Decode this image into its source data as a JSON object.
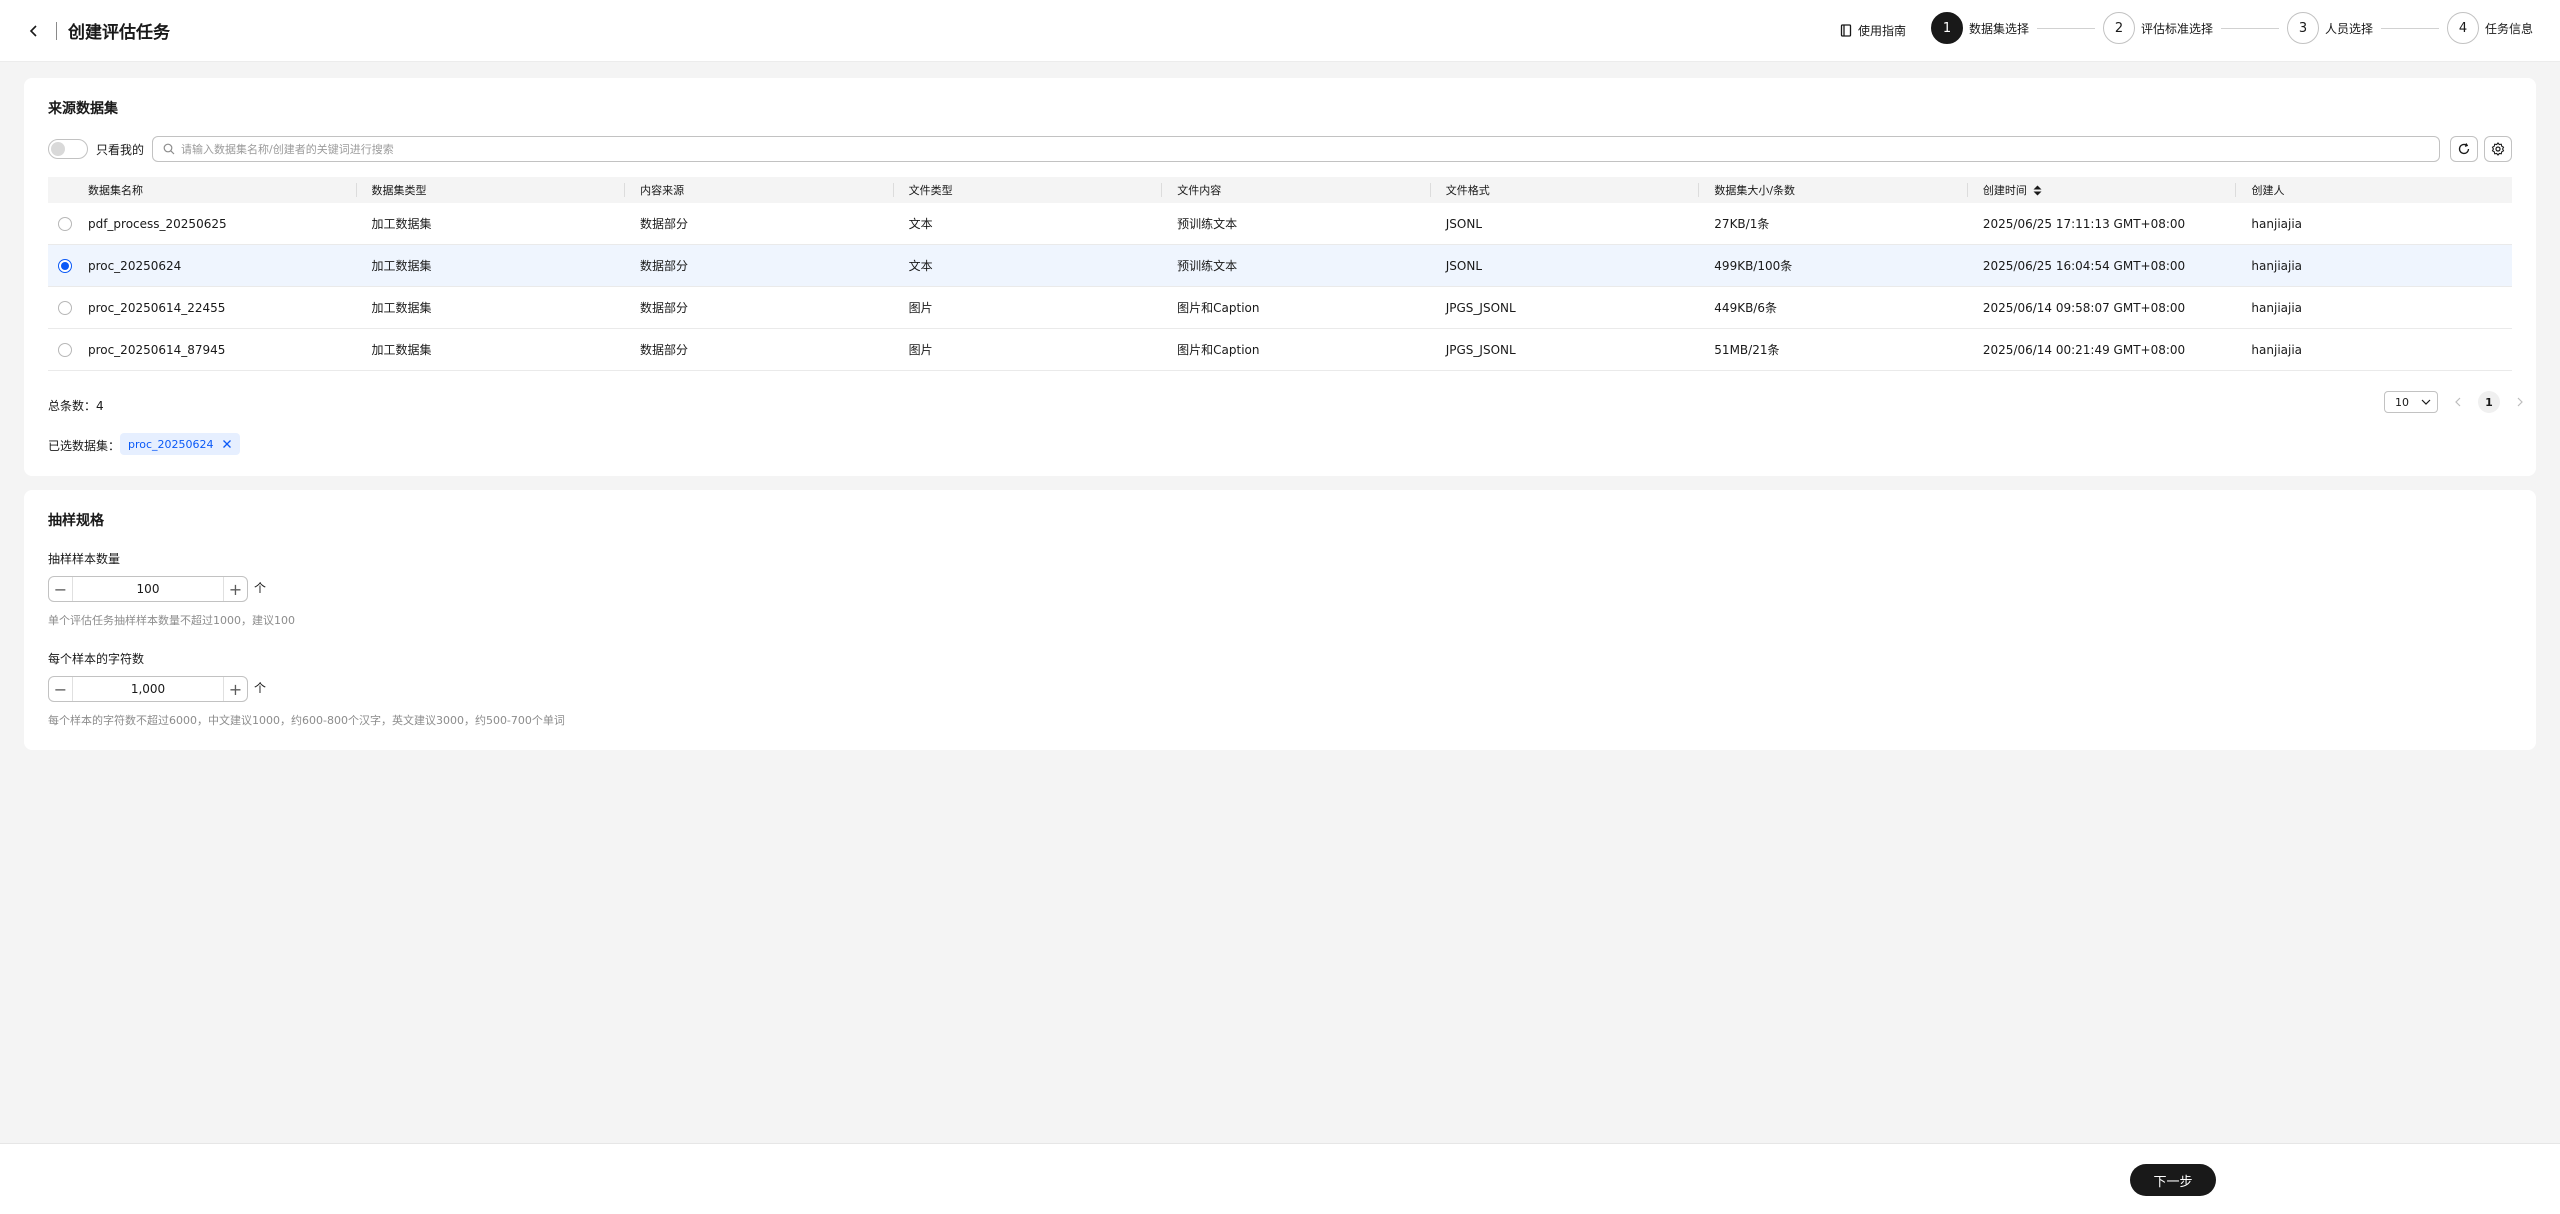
{
  "header": {
    "title": "创建评估任务",
    "guide_label": "使用指南",
    "steps": [
      {
        "num": "1",
        "label": "数据集选择",
        "active": true
      },
      {
        "num": "2",
        "label": "评估标准选择",
        "active": false
      },
      {
        "num": "3",
        "label": "人员选择",
        "active": false
      },
      {
        "num": "4",
        "label": "任务信息",
        "active": false
      }
    ]
  },
  "source": {
    "title": "来源数据集",
    "only_mine_label": "只看我的",
    "search_placeholder": "请输入数据集名称/创建者的关键词进行搜索",
    "columns": [
      "数据集名称",
      "数据集类型",
      "内容来源",
      "文件类型",
      "文件内容",
      "文件格式",
      "数据集大小/条数",
      "创建时间",
      "创建人"
    ],
    "rows": [
      {
        "selected": false,
        "cells": [
          "pdf_process_20250625",
          "加工数据集",
          "数据部分",
          "文本",
          "预训练文本",
          "JSONL",
          "27KB/1条",
          "2025/06/25 17:11:13 GMT+08:00",
          "hanjiajia"
        ]
      },
      {
        "selected": true,
        "cells": [
          "proc_20250624",
          "加工数据集",
          "数据部分",
          "文本",
          "预训练文本",
          "JSONL",
          "499KB/100条",
          "2025/06/25 16:04:54 GMT+08:00",
          "hanjiajia"
        ]
      },
      {
        "selected": false,
        "cells": [
          "proc_20250614_22455",
          "加工数据集",
          "数据部分",
          "图片",
          "图片和Caption",
          "JPGS_JSONL",
          "449KB/6条",
          "2025/06/14 09:58:07 GMT+08:00",
          "hanjiajia"
        ]
      },
      {
        "selected": false,
        "cells": [
          "proc_20250614_87945",
          "加工数据集",
          "数据部分",
          "图片",
          "图片和Caption",
          "JPGS_JSONL",
          "51MB/21条",
          "2025/06/14 00:21:49 GMT+08:00",
          "hanjiajia"
        ]
      }
    ],
    "total_label": "总条数：4",
    "page_size": "10",
    "current_page": "1",
    "selected_label": "已选数据集：",
    "selected_tag": "proc_20250624"
  },
  "sampling": {
    "title": "抽样规格",
    "count_label": "抽样样本数量",
    "count_value": "100",
    "unit": "个",
    "count_hint": "单个评估任务抽样样本数量不超过1000，建议100",
    "chars_label": "每个样本的字符数",
    "chars_value": "1,000",
    "chars_hint": "每个样本的字符数不超过6000，中文建议1000，约600-800个汉字，英文建议3000，约500-700个单词"
  },
  "footer": {
    "next_label": "下一步"
  },
  "colors": {
    "accent": "#0a59f7",
    "dark": "#191919",
    "selected_row": "#eff5fe"
  }
}
